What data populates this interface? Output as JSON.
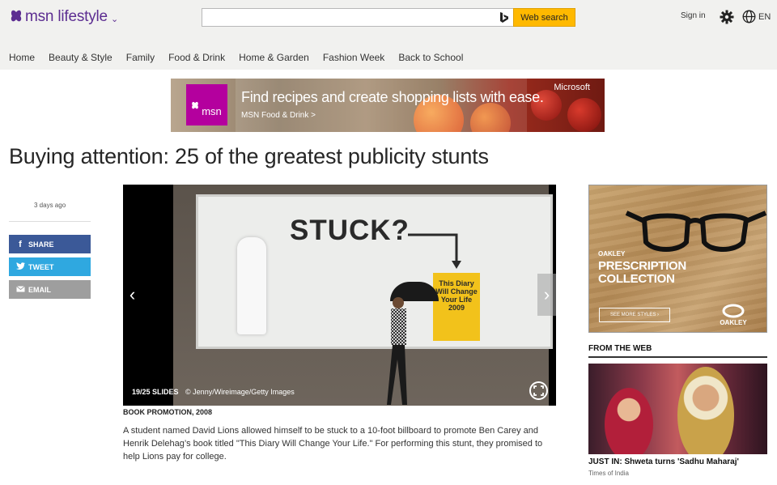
{
  "header": {
    "brand": "msn lifestyle",
    "search": {
      "value": "",
      "placeholder": ""
    },
    "search_button": "Web search",
    "signin": "Sign in",
    "lang": "EN"
  },
  "nav": [
    "Home",
    "Beauty & Style",
    "Family",
    "Food & Drink",
    "Home & Garden",
    "Fashion Week",
    "Back to School"
  ],
  "banner": {
    "logo": "msn",
    "headline": "Find recipes and create shopping lists with ease.",
    "cta": "MSN Food & Drink >",
    "sponsor": "Microsoft"
  },
  "article": {
    "title": "Buying attention: 25 of the greatest publicity stunts",
    "published": "3 days ago",
    "share": {
      "facebook": "SHARE",
      "twitter": "TWEET",
      "email": "EMAIL"
    },
    "slide": {
      "billboard_word": "STUCK?",
      "book_text": "This Diary Will Change Your Life 2009",
      "counter": "19/25 SLIDES",
      "credit": "© Jenny/Wireimage/Getty Images"
    },
    "caption_heading": "BOOK PROMOTION, 2008",
    "caption_body": "A student named David Lions allowed himself to be stuck to a 10-foot billboard to promote Ben Carey and Henrik Delehag’s book titled \"This Diary Will Change Your Life.\" For performing this stunt, they promised to help Lions pay for college."
  },
  "ad": {
    "brand": "OAKLEY",
    "headline_1": "PRESCRIPTION",
    "headline_2": "COLLECTION",
    "button": "SEE MORE STYLES ›",
    "logo": "OAKLEY"
  },
  "from_web": {
    "heading": "FROM THE WEB",
    "headline": "JUST IN: Shweta turns 'Sadhu Maharaj'",
    "source": "Times of India"
  },
  "colors": {
    "brand_purple": "#5c2d91",
    "search_yellow": "#ffb900",
    "facebook": "#3b5998",
    "twitter": "#2fa8e0",
    "email": "#9e9e9e"
  }
}
